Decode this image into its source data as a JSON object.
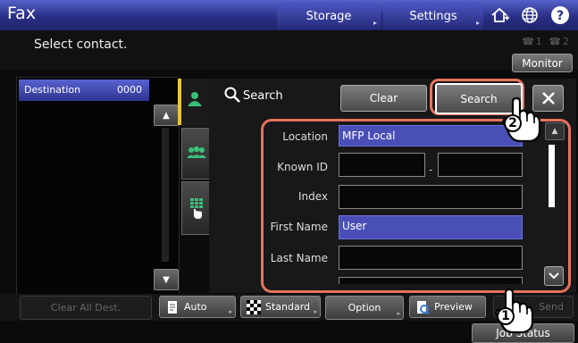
{
  "header": {
    "title": "Fax",
    "tabs": [
      {
        "label": "Storage"
      },
      {
        "label": "Settings"
      }
    ],
    "icons": [
      "home-add-icon",
      "globe-icon",
      "help-icon"
    ]
  },
  "message": {
    "text": "Select contact.",
    "monitor_label": "Monitor",
    "line_indicators": "☎1 ☎2"
  },
  "destination": {
    "label": "Destination",
    "count": "0000"
  },
  "search": {
    "title": "Search",
    "clear_label": "Clear",
    "search_label": "Search",
    "fields": {
      "location": {
        "label": "Location",
        "value": "MFP Local"
      },
      "known_id": {
        "label": "Known ID",
        "value_1": "",
        "value_2": "",
        "separator": "-"
      },
      "index": {
        "label": "Index",
        "value": ""
      },
      "first_name": {
        "label": "First Name",
        "value": "User"
      },
      "last_name": {
        "label": "Last Name",
        "value": ""
      }
    }
  },
  "bottom": {
    "clear_all": "Clear All Dest.",
    "auto": "Auto",
    "standard": "Standard",
    "option": "Option",
    "preview": "Preview",
    "send": "Send"
  },
  "status": {
    "job_status": "Job Status"
  },
  "callouts": {
    "first": "1",
    "second": "2"
  },
  "colors": {
    "header_blue": "#2a2f86",
    "accent_yellow": "#e7c63a",
    "highlight_orange": "#e6735d",
    "selected_field": "#4a4fb8"
  }
}
